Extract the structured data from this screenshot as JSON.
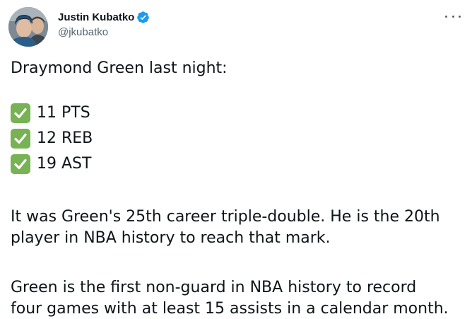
{
  "author": {
    "display_name": "Justin Kubatko",
    "handle": "@jkubatko",
    "verified_color": "#1d9bf0"
  },
  "menu": {
    "icon": "more-horizontal-icon"
  },
  "tweet": {
    "intro": "Draymond Green last night:",
    "stats": [
      {
        "icon": "check-mark-box-icon",
        "text": "11 PTS"
      },
      {
        "icon": "check-mark-box-icon",
        "text": "12 REB"
      },
      {
        "icon": "check-mark-box-icon",
        "text": "19 AST"
      }
    ],
    "paragraph1_line1": "It was Green's 25th career triple-double. He is the 20th",
    "paragraph1_line2": "player in NBA history to reach that mark.",
    "paragraph2_line1": "Green is the first non-guard in NBA history to record",
    "paragraph2_line2": "four games with at least 15 assists in a calendar month."
  },
  "colors": {
    "text": "#0f1419",
    "secondary_text": "#536471",
    "check_green": "#77b255"
  }
}
